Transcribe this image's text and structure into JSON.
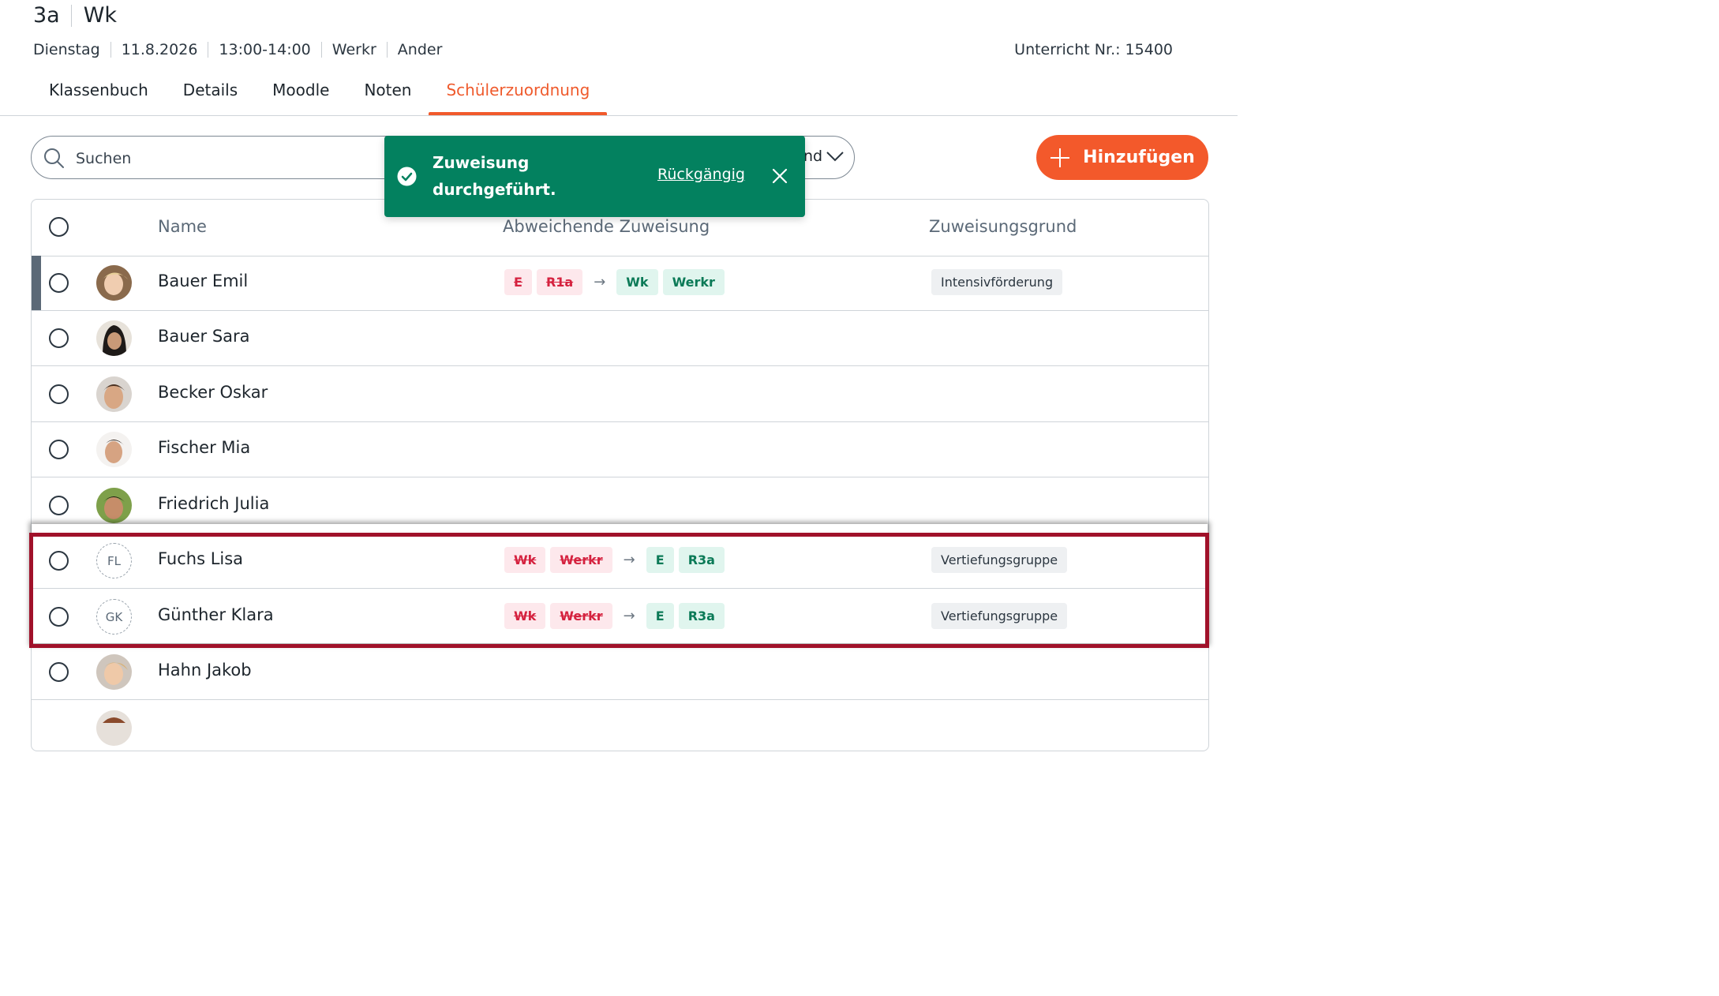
{
  "header": {
    "class": "3a",
    "subject": "Wk",
    "meta": [
      "Dienstag",
      "11.8.2026",
      "13:00-14:00",
      "Werkr",
      "Ander"
    ],
    "lesson_number": "Unterricht Nr.: 15400"
  },
  "tabs": [
    "Klassenbuch",
    "Details",
    "Moodle",
    "Noten",
    "Schülerzuordnung"
  ],
  "active_tab": "Schülerzuordnung",
  "search": {
    "placeholder": "Suchen",
    "filter_tail": "nd"
  },
  "add_button": "Hinzufügen",
  "toast": {
    "message": "Zuweisung durchgeführt.",
    "undo": "Rückgängig"
  },
  "table": {
    "headers": {
      "name": "Name",
      "assignment": "Abweichende Zuweisung",
      "reason": "Zuweisungsgrund"
    },
    "rows": [
      {
        "name": "Bauer Emil",
        "avatar": "photo",
        "old": [
          "E",
          "R1a"
        ],
        "new": [
          "Wk",
          "Werkr"
        ],
        "reason": "Intensivförderung"
      },
      {
        "name": "Bauer Sara",
        "avatar": "photo"
      },
      {
        "name": "Becker Oskar",
        "avatar": "photo"
      },
      {
        "name": "Fischer Mia",
        "avatar": "photo"
      },
      {
        "name": "Friedrich Julia",
        "avatar": "photo"
      },
      {
        "name": "Fuchs Lisa",
        "initials": "FL",
        "old": [
          "Wk",
          "Werkr"
        ],
        "new": [
          "E",
          "R3a"
        ],
        "reason": "Vertiefungsgruppe"
      },
      {
        "name": "Günther Klara",
        "initials": "GK",
        "old": [
          "Wk",
          "Werkr"
        ],
        "new": [
          "E",
          "R3a"
        ],
        "reason": "Vertiefungsgruppe"
      },
      {
        "name": "Hahn Jakob",
        "avatar": "photo"
      }
    ]
  },
  "colors": {
    "accent": "#f3592b",
    "toast": "#03815f",
    "highlight": "#a0112a",
    "old_chip": "#d5223f",
    "new_chip": "#0b7a57"
  }
}
